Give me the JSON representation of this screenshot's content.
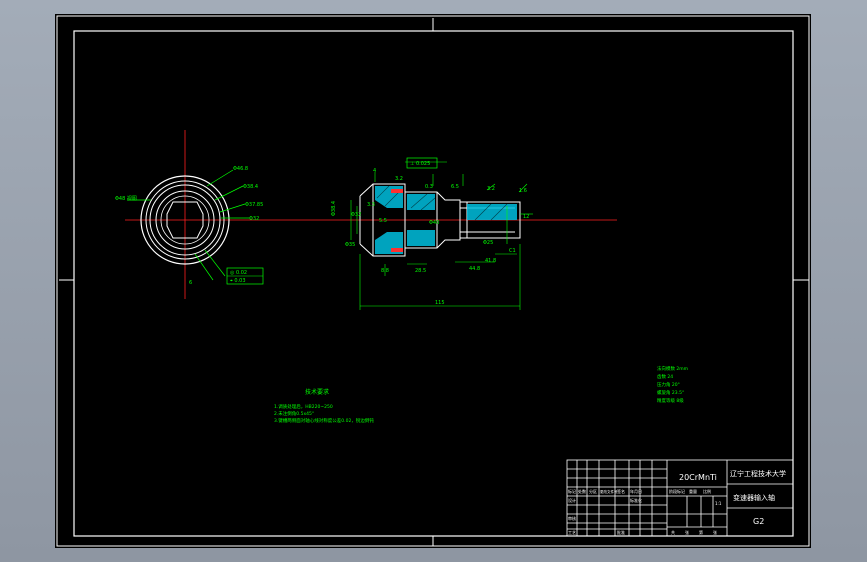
{
  "colors": {
    "background": "#000000",
    "frame": "#ffffff",
    "centerline": "#ff2020",
    "dimension": "#00ff00",
    "part_outline": "#ffffff",
    "hatch": "#00e0ff",
    "text_block": "#00ff00"
  },
  "left_view": {
    "labels": {
      "a": "Φ46.8",
      "b": "Φ38.4",
      "c": "Φ37.85",
      "d": "Φ32",
      "left": "Φ48 视图"
    },
    "tolerance_box": {
      "row1": "◎ 0.02",
      "row2": "⌖ 0.03"
    },
    "bottom_mark": "6"
  },
  "main_view": {
    "tolerance_box": "⊥ 0.025",
    "labels": {
      "top_1": "4",
      "top_2": "3.2",
      "top_3": "0.3",
      "top_4": "6.5",
      "top_5": "3.2",
      "top_6": "1.6",
      "left_1": "Φ38.4",
      "left_2": "Φ32",
      "left_3": "Φ35",
      "mid_1": "3.3",
      "mid_2": "5.5",
      "mid_3": "Φ40",
      "mid_4": "Φ25",
      "right_1": "12",
      "bot_1": "8.8",
      "bot_2": "28.5",
      "bot_3": "44.8",
      "bot_4": "41.8",
      "bot_5": "C1"
    },
    "overall_length": "115"
  },
  "notes": {
    "title": "技术要求",
    "lines": [
      "1.调质处理后，HB220~250",
      "2.未注倒角0.5x45°",
      "3.键槽两侧面对轴心线对称度公差0.02，锐边倒钝"
    ]
  },
  "gear_params": {
    "lines": [
      "法向模数 2mm",
      "齿数 24",
      "压力角 20°",
      "螺旋角 23.5°",
      "精度等级 8级"
    ]
  },
  "title_block": {
    "material": "20CrMnTi",
    "university": "辽宁工程技术大学",
    "drawing_name": "变速器输入轴",
    "sheet_code": "G2",
    "rev_headers": [
      "标记",
      "处数",
      "分区",
      "更改文件号",
      "签名",
      "年月日"
    ],
    "design_row": [
      "设计",
      "",
      "",
      "标准化",
      "",
      ""
    ],
    "stage_headers": [
      "阶段标记",
      "重量",
      "比例"
    ],
    "scale": "1:1",
    "review_label": "审核",
    "process_label": "工艺",
    "approve_label": "批准",
    "sheet_info": [
      "共",
      "张",
      "第",
      "张"
    ]
  }
}
